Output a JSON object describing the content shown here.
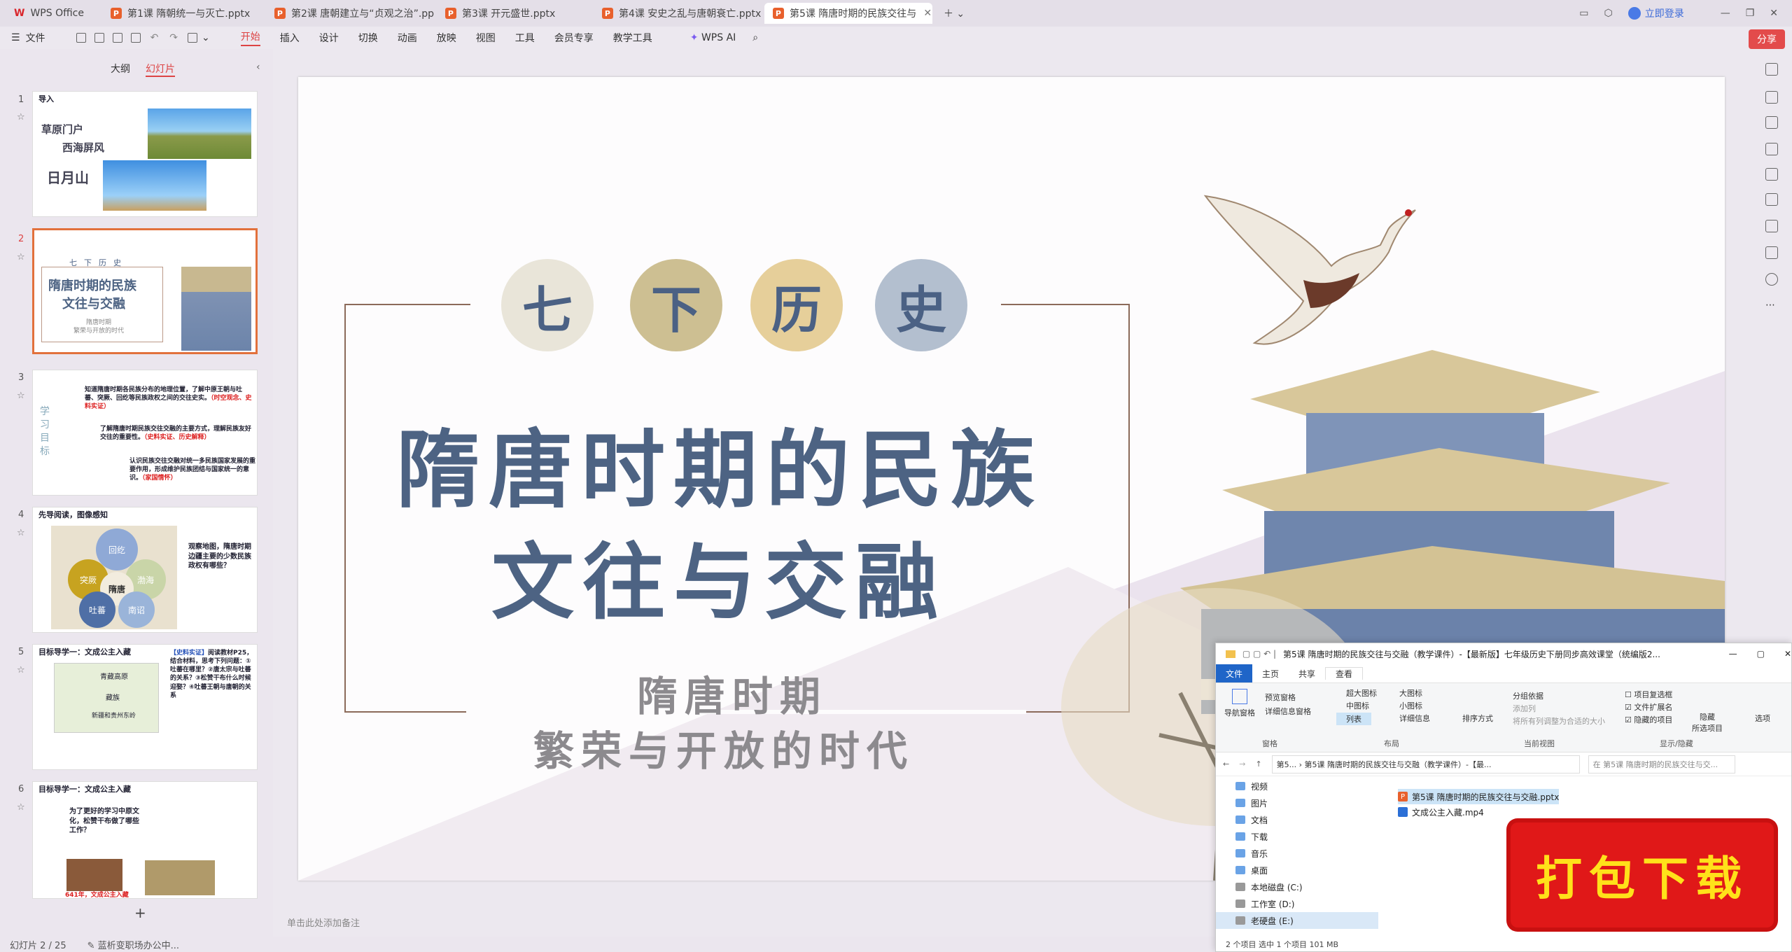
{
  "app": {
    "name": "WPS Office"
  },
  "tabs": [
    {
      "label": "第1课 隋朝统一与灭亡.pptx"
    },
    {
      "label": "第2课 唐朝建立与“贞观之治”.pptx"
    },
    {
      "label": "第3课 开元盛世.pptx"
    },
    {
      "label": "第4课 安史之乱与唐朝衰亡.pptx"
    },
    {
      "label": "第5课 隋唐时期的民族交往与"
    }
  ],
  "window": {
    "login": "立即登录",
    "share": "分享"
  },
  "menu": {
    "file": "文件",
    "items": [
      "开始",
      "插入",
      "设计",
      "切换",
      "动画",
      "放映",
      "视图",
      "工具",
      "会员专享",
      "教学工具"
    ],
    "ai": "WPS AI"
  },
  "left_panel": {
    "tab_outline": "大纲",
    "tab_slides": "幻灯片",
    "slides": [
      {
        "num": "1",
        "label": "导入",
        "lines": [
          "草原门户",
          "西海屏风",
          "日月山"
        ]
      },
      {
        "num": "2",
        "chars": [
          "七",
          "下",
          "历",
          "史"
        ],
        "title1": "隋唐时期的民族",
        "title2": "文往与交融",
        "sub1": "隋唐时期",
        "sub2": "繁荣与开放的时代"
      },
      {
        "num": "3",
        "side": "学习目标",
        "items": [
          "知道隋唐时期各民族分布的地理位置，了解中原王朝与吐蕃、突厥、回纥等民族政权之间的交往史实。",
          "了解隋唐时期民族交往交融的主要方式，理解民族友好交往的重要性。",
          "认识民族交往交融对统一多民族国家发展的重要作用，形成维护民族团结与国家统一的意识。"
        ],
        "tags": [
          "（时空观念、史料实证）",
          "（史料实证、历史解释）",
          "（家国情怀）"
        ]
      },
      {
        "num": "4",
        "label": "先导阅读，图像感知",
        "regions": [
          "回纥",
          "突厥",
          "渤海",
          "隋唐",
          "吐蕃",
          "南诏"
        ],
        "text": "观察地图，隋唐时期边疆主要的少数民族政权有哪些？"
      },
      {
        "num": "5",
        "label": "目标导学一：文成公主入藏",
        "map": [
          "青藏高原",
          "藏族",
          "新疆和贵州东岭"
        ],
        "tag": "【史料实证】",
        "text": "阅读教材P25，结合材料，思考下列问题：①吐蕃在哪里？②唐太宗与吐蕃的关系？③松赞干布什么时候迎娶？④吐蕃王朝与唐朝的关系"
      },
      {
        "num": "6",
        "label": "目标导学一：文成公主入藏",
        "text": "为了更好的学习中原文化，松赞干布做了哪些工作？",
        "bottom": "641年，文成公主入藏"
      }
    ]
  },
  "slide": {
    "chars": [
      "七",
      "下",
      "历",
      "史"
    ],
    "title1": "隋唐时期的民族",
    "title2": "文往与交融",
    "sub1": "隋唐时期",
    "sub2": "繁荣与开放的时代",
    "notes": "单击此处添加备注"
  },
  "status": {
    "page": "幻灯片 2 / 25",
    "helper": "蓝析变职场办公中..."
  },
  "explorer": {
    "title": "第5课 隋唐时期的民族交往与交融（教学课件）-【最新版】七年级历史下册同步高效课堂（统编版2...",
    "menu": [
      "文件",
      "主页",
      "共享",
      "查看"
    ],
    "ribbon": {
      "nav": "导航窗格",
      "preview": "预览窗格",
      "details": "详细信息窗格",
      "group_pane": "窗格",
      "layouts": [
        "超大图标",
        "大图标",
        "中图标",
        "小图标",
        "列表",
        "详细信息"
      ],
      "group_layout": "布局",
      "sort": "排序方式",
      "groupby": "分组依据",
      "addcol": "添加列",
      "fitcol": "将所有列调整为合适的大小",
      "group_view": "当前视图",
      "checks": [
        "项目复选框",
        "文件扩展名",
        "隐藏的项目"
      ],
      "hide": "隐藏",
      "selected": "所选项目",
      "options": "选项",
      "group_show": "显示/隐藏"
    },
    "address": "第5... › 第5课 隋唐时期的民族交往与交融（教学课件）-【最...",
    "search": "在 第5课 隋唐时期的民族交往与交...",
    "tree": [
      "视频",
      "图片",
      "文档",
      "下载",
      "音乐",
      "桌面",
      "本地磁盘 (C:)",
      "工作室 (D:)",
      "老硬盘 (E:)"
    ],
    "files": [
      "第5课 隋唐时期的民族交往与交融.pptx",
      "文成公主入藏.mp4"
    ],
    "status": "2 个项目    选中 1 个项目  101 MB"
  },
  "download": {
    "label": "打包下载"
  },
  "colors": {
    "accent": "#d44444",
    "title_blue": "#4d6383",
    "badge_red": "#e01818",
    "badge_yellow": "#ffe11a"
  }
}
